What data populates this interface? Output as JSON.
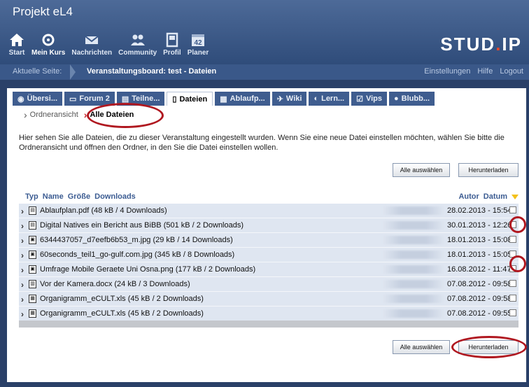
{
  "header": {
    "project_title": "Projekt eL4",
    "logo_main": "Stud",
    "logo_dot": ".",
    "logo_end": "IP",
    "nav": [
      {
        "label": "Start",
        "icon": "home-icon"
      },
      {
        "label": "Mein Kurs",
        "icon": "course-icon"
      },
      {
        "label": "Nachrichten",
        "icon": "mail-icon"
      },
      {
        "label": "Community",
        "icon": "community-icon"
      },
      {
        "label": "Profil",
        "icon": "profile-icon"
      },
      {
        "label": "Planer",
        "icon": "calendar-icon",
        "badge": "42"
      }
    ]
  },
  "breadcrumb": {
    "label": "Aktuelle Seite:",
    "value": "Veranstaltungsboard: test - Dateien",
    "links": [
      "Einstellungen",
      "Hilfe",
      "Logout"
    ]
  },
  "tabs": [
    {
      "label": "Übersi...",
      "icon": "overview-icon"
    },
    {
      "label": "Forum 2",
      "icon": "forum-icon"
    },
    {
      "label": "Teilne...",
      "icon": "participants-icon"
    },
    {
      "label": "Dateien",
      "icon": "files-icon",
      "active": true
    },
    {
      "label": "Ablaufp...",
      "icon": "schedule-icon"
    },
    {
      "label": "Wiki",
      "icon": "wiki-icon"
    },
    {
      "label": "Lern...",
      "icon": "learning-icon"
    },
    {
      "label": "Vips",
      "icon": "vips-icon"
    },
    {
      "label": "Blubb...",
      "icon": "blubber-icon"
    }
  ],
  "subnav": {
    "folder_view": "Ordneransicht",
    "all_files": "Alle Dateien"
  },
  "intro_text": "Hier sehen Sie alle Dateien, die zu dieser Veranstaltung eingestellt wurden. Wenn Sie eine neue Datei einstellen möchten, wählen Sie bitte die Ordneransicht und öffnen den Ordner, in den Sie die Datei einstellen wollen.",
  "buttons": {
    "select_all": "Alle auswählen",
    "download": "Herunterladen"
  },
  "table": {
    "headers": {
      "type": "Typ",
      "name": "Name",
      "size": "Größe",
      "downloads": "Downloads",
      "author": "Autor",
      "date": "Datum"
    },
    "rows": [
      {
        "name": "Ablaufplan.pdf  (48 kB / 4 Downloads)",
        "date": "28.02.2013 - 15:54",
        "type": "pdf"
      },
      {
        "name": "Digital Natives ein Bericht aus BiBB  (501 kB / 2 Downloads)",
        "date": "30.01.2013 - 12:26",
        "type": "pdf"
      },
      {
        "name": "6344437057_d7eefb6b53_m.jpg  (29 kB / 14 Downloads)",
        "date": "18.01.2013 - 15:08",
        "type": "img"
      },
      {
        "name": "60seconds_teil1_go-gulf.com.jpg  (345 kB / 8 Downloads)",
        "date": "18.01.2013 - 15:05",
        "type": "img"
      },
      {
        "name": "Umfrage Mobile Geraete Uni Osna.png  (177 kB / 2 Downloads)",
        "date": "16.08.2012 - 11:47",
        "type": "img"
      },
      {
        "name": "Vor der Kamera.docx  (24 kB / 3 Downloads)",
        "date": "07.08.2012 - 09:58",
        "type": "doc"
      },
      {
        "name": "Organigramm_eCULT.xls  (45 kB / 2 Downloads)",
        "date": "07.08.2012 - 09:58",
        "type": "xls"
      },
      {
        "name": "Organigramm_eCULT.xls  (45 kB / 2 Downloads)",
        "date": "07.08.2012 - 09:55",
        "type": "xls"
      }
    ]
  },
  "colors": {
    "accent": "#3f5d8f",
    "highlight_ring": "#b01820",
    "sort_arrow": "#f3c11a",
    "logo_dot": "#e4482c"
  }
}
